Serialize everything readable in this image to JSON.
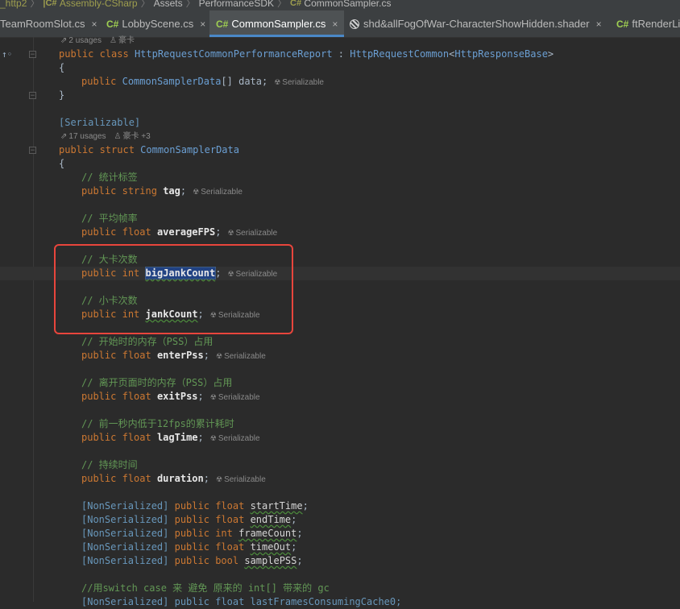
{
  "breadcrumb": {
    "items": [
      "_http2",
      "Assembly-CSharp",
      "Assets",
      "PerformanceSDK",
      "CommonSampler.cs"
    ],
    "cs_badge": "C#"
  },
  "tabs": [
    {
      "label": "TeamRoomSlot.cs",
      "icon": "csharp-icon",
      "active": false
    },
    {
      "label": "LobbyScene.cs",
      "icon": "csharp-icon",
      "active": false
    },
    {
      "label": "CommonSampler.cs",
      "icon": "csharp-icon",
      "active": true
    },
    {
      "label": "shd&allFogOfWar-CharacterShowHidden.shader",
      "icon": "shader-icon",
      "active": false
    },
    {
      "label": "ftRenderLi",
      "icon": "csharp-icon",
      "active": false
    }
  ],
  "tab_cs_label": "C#",
  "tab_close": "×",
  "usages": {
    "report": {
      "count": "2 usages",
      "user": "豪卡"
    },
    "struct": {
      "count": "17 usages",
      "user": "豪卡 +3"
    }
  },
  "hint_label": "Serializable",
  "code": {
    "class_kw": "public class",
    "class_name": "HttpRequestCommonPerformanceReport",
    "class_colon": " : ",
    "base_name": "HttpRequestCommon",
    "base_generic_open": "<",
    "base_generic": "HttpResponseBase",
    "base_generic_close": ">",
    "open_brace": "{",
    "close_brace": "}",
    "data_kw": "public",
    "data_type": "CommonSamplerData",
    "data_rest": "[] data;",
    "serializable_attr": "[Serializable]",
    "struct_kw": "public struct",
    "struct_name": "CommonSamplerData",
    "fields": [
      {
        "comment": "// 统计标签",
        "kw": "public",
        "type": "string",
        "name": "tag",
        "wavy": false
      },
      {
        "comment": "// 平均帧率",
        "kw": "public",
        "type": "float",
        "name": "averageFPS",
        "wavy": false
      },
      {
        "comment": "// 大卡次数",
        "kw": "public",
        "type": "int",
        "name": "bigJankCount",
        "wavy": true
      },
      {
        "comment": "// 小卡次数",
        "kw": "public",
        "type": "int",
        "name": "jankCount",
        "wavy": true
      },
      {
        "comment": "// 开始时的内存（PSS）占用",
        "kw": "public",
        "type": "float",
        "name": "enterPss",
        "wavy": false
      },
      {
        "comment": "// 离开页面时的内存（PSS）占用",
        "kw": "public",
        "type": "float",
        "name": "exitPss",
        "wavy": false
      },
      {
        "comment": "// 前一秒内低于12fps的累计耗时",
        "kw": "public",
        "type": "float",
        "name": "lagTime",
        "wavy": false
      },
      {
        "comment": "// 持续时间",
        "kw": "public",
        "type": "float",
        "name": "duration",
        "wavy": false
      }
    ],
    "nonserialized": [
      {
        "attr": "[NonSerialized]",
        "kw": "public",
        "type": "float",
        "name": "startTime"
      },
      {
        "attr": "[NonSerialized]",
        "kw": "public",
        "type": "float",
        "name": "endTime"
      },
      {
        "attr": "[NonSerialized]",
        "kw": "public",
        "type": "int",
        "name": "frameCount"
      },
      {
        "attr": "[NonSerialized]",
        "kw": "public",
        "type": "float",
        "name": "timeOut"
      },
      {
        "attr": "[NonSerialized]",
        "kw": "public",
        "type": "bool",
        "name": "samplePSS"
      }
    ],
    "last_comment": "//用switch case 来 避免 原来的 int[] 带来的 gc",
    "last_line_partial": "[NonSerialized] public float lastFramesConsumingCache0;"
  }
}
